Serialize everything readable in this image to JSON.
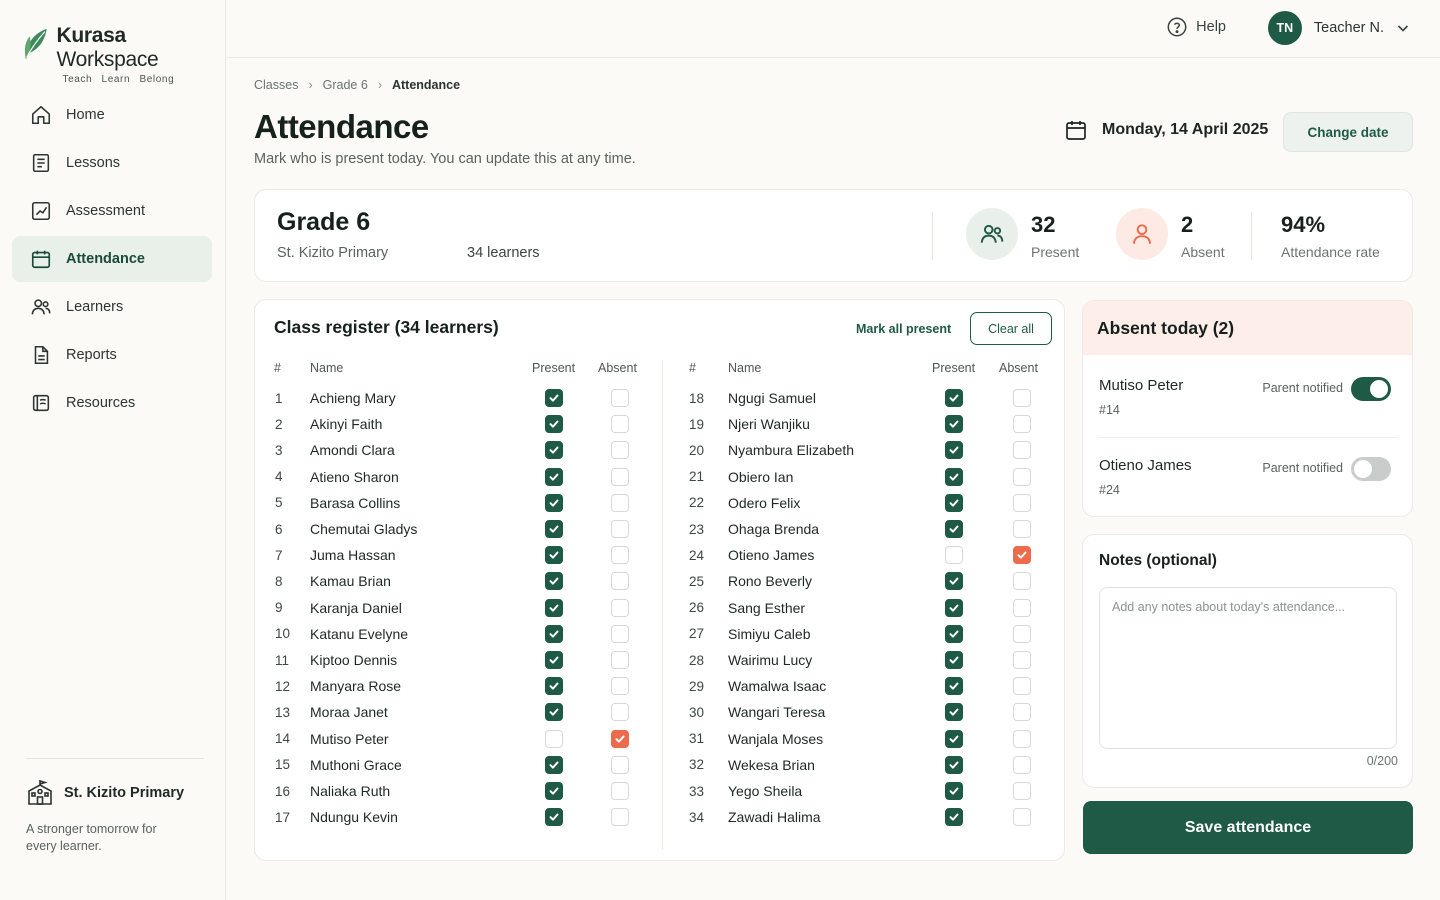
{
  "brand": {
    "name_bold": "Kurasa",
    "name_light": "Workspace",
    "tagline": "Teach Learn Belong"
  },
  "sidebar": {
    "items": [
      {
        "label": "Home",
        "icon": "home-icon"
      },
      {
        "label": "Lessons",
        "icon": "book-icon"
      },
      {
        "label": "Assessment",
        "icon": "chart-icon"
      },
      {
        "label": "Attendance",
        "icon": "calendar-icon",
        "active": true
      },
      {
        "label": "Learners",
        "icon": "users-icon"
      },
      {
        "label": "Reports",
        "icon": "document-icon"
      },
      {
        "label": "Resources",
        "icon": "open-book-icon"
      }
    ],
    "school": "St. Kizito Primary",
    "motto": "A stronger tomorrow for every learner."
  },
  "topbar": {
    "help": "Help",
    "user_initials": "TN",
    "user_name": "Teacher N."
  },
  "breadcrumb": [
    "Classes",
    "Grade 6",
    "Attendance"
  ],
  "page": {
    "title": "Attendance",
    "subtitle": "Mark who is present today. You can update this at any time.",
    "date": "Monday, 14 April 2025",
    "change_date": "Change date"
  },
  "summary": {
    "grade": "Grade 6",
    "school": "St. Kizito Primary",
    "learners": "34 learners",
    "present_num": "32",
    "present_label": "Present",
    "absent_num": "2",
    "absent_label": "Absent",
    "rate_num": "94%",
    "rate_label": "Attendance rate"
  },
  "register": {
    "title": "Class register (34 learners)",
    "mark_all": "Mark all present",
    "clear_all": "Clear all",
    "headers": {
      "num": "#",
      "name": "Name",
      "present": "Present",
      "absent": "Absent"
    },
    "learners": [
      {
        "n": "1",
        "name": "Achieng Mary",
        "status": "present"
      },
      {
        "n": "2",
        "name": "Akinyi Faith",
        "status": "present"
      },
      {
        "n": "3",
        "name": "Amondi Clara",
        "status": "present"
      },
      {
        "n": "4",
        "name": "Atieno Sharon",
        "status": "present"
      },
      {
        "n": "5",
        "name": "Barasa Collins",
        "status": "present"
      },
      {
        "n": "6",
        "name": "Chemutai Gladys",
        "status": "present"
      },
      {
        "n": "7",
        "name": "Juma Hassan",
        "status": "present"
      },
      {
        "n": "8",
        "name": "Kamau Brian",
        "status": "present"
      },
      {
        "n": "9",
        "name": "Karanja Daniel",
        "status": "present"
      },
      {
        "n": "10",
        "name": "Katanu Evelyne",
        "status": "present"
      },
      {
        "n": "11",
        "name": "Kiptoo Dennis",
        "status": "present"
      },
      {
        "n": "12",
        "name": "Manyara Rose",
        "status": "present"
      },
      {
        "n": "13",
        "name": "Moraa Janet",
        "status": "present"
      },
      {
        "n": "14",
        "name": "Mutiso Peter",
        "status": "absent"
      },
      {
        "n": "15",
        "name": "Muthoni Grace",
        "status": "present"
      },
      {
        "n": "16",
        "name": "Naliaka Ruth",
        "status": "present"
      },
      {
        "n": "17",
        "name": "Ndungu Kevin",
        "status": "present"
      },
      {
        "n": "18",
        "name": "Ngugi Samuel",
        "status": "present"
      },
      {
        "n": "19",
        "name": "Njeri Wanjiku",
        "status": "present"
      },
      {
        "n": "20",
        "name": "Nyambura Elizabeth",
        "status": "present"
      },
      {
        "n": "21",
        "name": "Obiero Ian",
        "status": "present"
      },
      {
        "n": "22",
        "name": "Odero Felix",
        "status": "present"
      },
      {
        "n": "23",
        "name": "Ohaga Brenda",
        "status": "present"
      },
      {
        "n": "24",
        "name": "Otieno James",
        "status": "absent"
      },
      {
        "n": "25",
        "name": "Rono Beverly",
        "status": "present"
      },
      {
        "n": "26",
        "name": "Sang Esther",
        "status": "present"
      },
      {
        "n": "27",
        "name": "Simiyu Caleb",
        "status": "present"
      },
      {
        "n": "28",
        "name": "Wairimu Lucy",
        "status": "present"
      },
      {
        "n": "29",
        "name": "Wamalwa Isaac",
        "status": "present"
      },
      {
        "n": "30",
        "name": "Wangari Teresa",
        "status": "present"
      },
      {
        "n": "31",
        "name": "Wanjala Moses",
        "status": "present"
      },
      {
        "n": "32",
        "name": "Wekesa Brian",
        "status": "present"
      },
      {
        "n": "33",
        "name": "Yego Sheila",
        "status": "present"
      },
      {
        "n": "34",
        "name": "Zawadi Halima",
        "status": "present"
      }
    ]
  },
  "absent_today": {
    "title": "Absent today (2)",
    "items": [
      {
        "name": "Mutiso Peter",
        "id": "#14",
        "notified_label": "Parent notified",
        "notified": true
      },
      {
        "name": "Otieno James",
        "id": "#24",
        "notified_label": "Parent notified",
        "notified": false
      }
    ]
  },
  "notes": {
    "title": "Notes (optional)",
    "placeholder": "Add any notes about today's attendance...",
    "count": "0/200"
  },
  "save": "Save attendance",
  "colors": {
    "primary": "#1f5a47",
    "absent": "#ec6b4c",
    "absent_bg": "#fdeeea"
  }
}
